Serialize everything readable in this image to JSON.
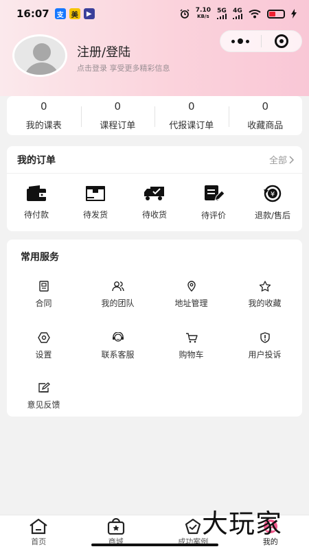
{
  "status_bar": {
    "time": "16:07",
    "net_speed_value": "7.10",
    "net_speed_unit": "KB/s",
    "signal_5g": "5G",
    "signal_4g": "4G",
    "app_icons": [
      {
        "name": "alipay-icon",
        "glyph": "支",
        "color": "#1677ff"
      },
      {
        "name": "meituan-icon",
        "glyph": "美",
        "color": "#f5c400"
      },
      {
        "name": "video-app-icon",
        "glyph": "▶",
        "color": "#3a3f9a"
      }
    ]
  },
  "profile": {
    "title": "注册/登陆",
    "subtitle": "点击登录 享受更多精彩信息"
  },
  "stats": [
    {
      "count": "0",
      "label": "我的课表"
    },
    {
      "count": "0",
      "label": "课程订单"
    },
    {
      "count": "0",
      "label": "代报课订单"
    },
    {
      "count": "0",
      "label": "收藏商品"
    }
  ],
  "orders": {
    "title": "我的订单",
    "all_label": "全部",
    "items": [
      {
        "icon": "wallet-icon",
        "label": "待付款"
      },
      {
        "icon": "package-icon",
        "label": "待发货"
      },
      {
        "icon": "delivery-truck-icon",
        "label": "待收货"
      },
      {
        "icon": "review-edit-icon",
        "label": "待评价"
      },
      {
        "icon": "refund-icon",
        "label": "退款/售后"
      }
    ]
  },
  "services": {
    "title": "常用服务",
    "items": [
      {
        "icon": "contract-icon",
        "label": "合同"
      },
      {
        "icon": "team-icon",
        "label": "我的团队"
      },
      {
        "icon": "location-pin-icon",
        "label": "地址管理"
      },
      {
        "icon": "star-icon",
        "label": "我的收藏"
      },
      {
        "icon": "settings-icon",
        "label": "设置"
      },
      {
        "icon": "customer-service-icon",
        "label": "联系客服"
      },
      {
        "icon": "cart-icon",
        "label": "购物车"
      },
      {
        "icon": "complaint-icon",
        "label": "用户投诉"
      },
      {
        "icon": "feedback-icon",
        "label": "意见反馈"
      }
    ]
  },
  "tabbar": [
    {
      "icon": "home-icon",
      "label": "首页"
    },
    {
      "icon": "shop-bag-icon",
      "label": "商城"
    },
    {
      "icon": "success-case-icon",
      "label": "成功案例"
    },
    {
      "icon": "profile-icon",
      "label": "我的",
      "active": true
    }
  ],
  "watermark": "大玩家",
  "colors": {
    "header_gradient_start": "#fbe9ec",
    "header_gradient_end": "#f9c7d6",
    "background": "#f2f2f2",
    "battery_low": "#ee2233"
  }
}
